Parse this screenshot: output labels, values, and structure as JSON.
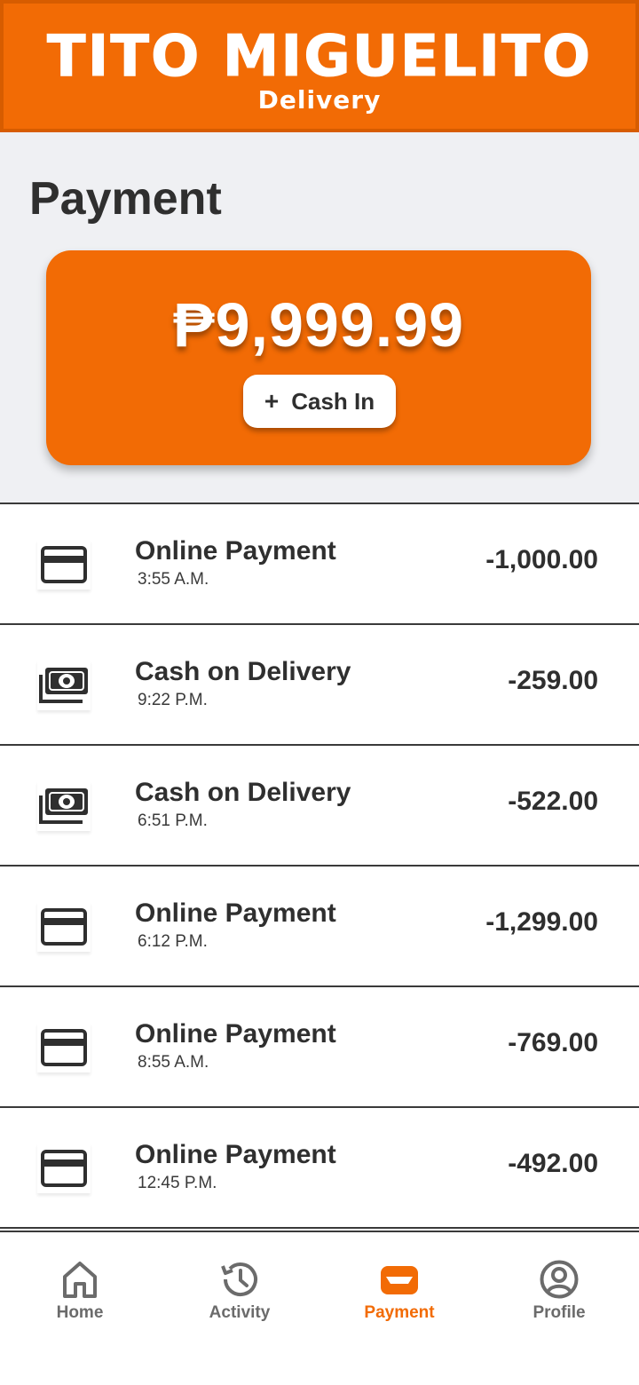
{
  "header": {
    "brand_title": "TITO MIGUELITO",
    "brand_subtitle": "Delivery"
  },
  "page": {
    "title": "Payment"
  },
  "wallet": {
    "balance": "₱9,999.99",
    "cash_in_label": "Cash In",
    "cash_in_icon": "+"
  },
  "transactions": [
    {
      "type": "Online Payment",
      "time": "3:55 A.M.",
      "amount": "-1,000.00",
      "icon": "credit-card-icon"
    },
    {
      "type": "Cash on Delivery",
      "time": "9:22 P.M.",
      "amount": "-259.00",
      "icon": "cash-icon"
    },
    {
      "type": "Cash on Delivery",
      "time": "6:51 P.M.",
      "amount": "-522.00",
      "icon": "cash-icon"
    },
    {
      "type": "Online Payment",
      "time": "6:12 P.M.",
      "amount": "-1,299.00",
      "icon": "credit-card-icon"
    },
    {
      "type": "Online Payment",
      "time": "8:55 A.M.",
      "amount": "-769.00",
      "icon": "credit-card-icon"
    },
    {
      "type": "Online Payment",
      "time": "12:45 P.M.",
      "amount": "-492.00",
      "icon": "credit-card-icon"
    }
  ],
  "nav": {
    "items": [
      {
        "label": "Home",
        "icon": "home-icon",
        "active": false
      },
      {
        "label": "Activity",
        "icon": "history-icon",
        "active": false
      },
      {
        "label": "Payment",
        "icon": "wallet-icon",
        "active": true
      },
      {
        "label": "Profile",
        "icon": "profile-icon",
        "active": false
      }
    ]
  },
  "colors": {
    "brand_orange": "#f26b05",
    "header_border": "#d75c00",
    "top_background": "#eff0f3",
    "text_dark": "#2f2f2f",
    "nav_inactive": "#6b6b6b"
  }
}
